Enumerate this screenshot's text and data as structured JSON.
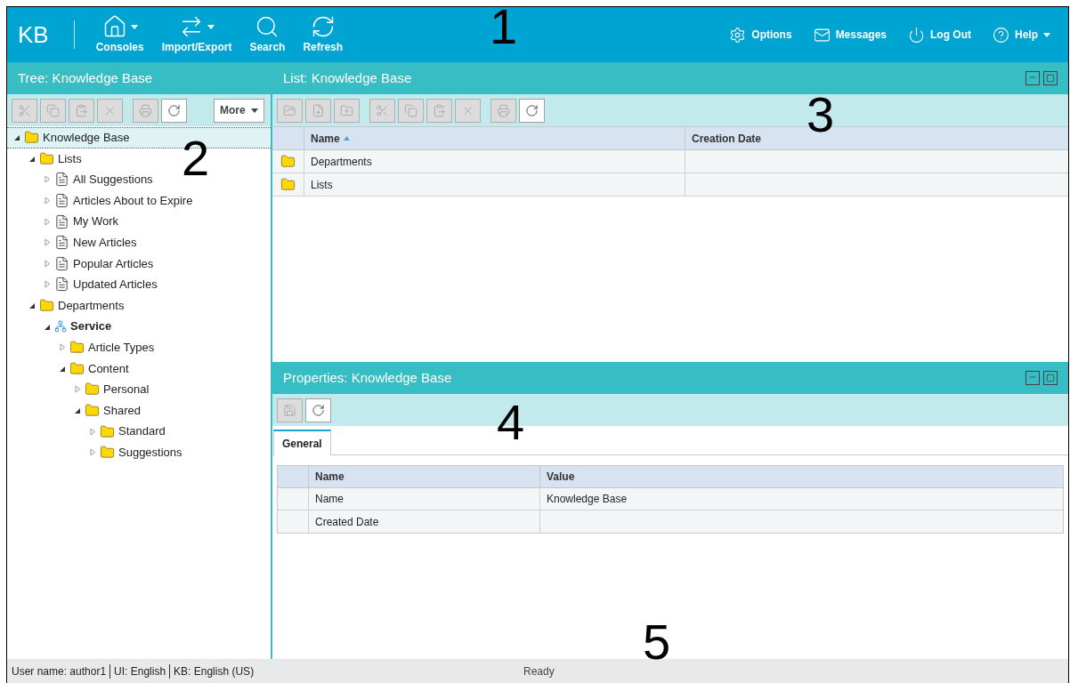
{
  "top_bar": {
    "logo": "KB",
    "tools": [
      {
        "label": "Consoles",
        "dropdown": true
      },
      {
        "label": "Import/Export",
        "dropdown": true
      },
      {
        "label": "Search",
        "dropdown": false
      },
      {
        "label": "Refresh",
        "dropdown": false
      }
    ],
    "links": [
      {
        "label": "Options",
        "dropdown": false
      },
      {
        "label": "Messages",
        "dropdown": false
      },
      {
        "label": "Log Out",
        "dropdown": false
      },
      {
        "label": "Help",
        "dropdown": true
      }
    ]
  },
  "tree_panel": {
    "title": "Tree: Knowledge Base",
    "toolbar": [
      [
        {
          "kind": "cut",
          "disabled": true
        },
        {
          "kind": "copy",
          "disabled": true
        },
        {
          "kind": "paste",
          "disabled": true
        },
        {
          "kind": "delete",
          "disabled": true
        }
      ],
      [
        {
          "kind": "print",
          "disabled": true
        },
        {
          "kind": "refresh",
          "disabled": false
        }
      ]
    ],
    "more_button": "More",
    "tree": [
      {
        "label": "Knowledge Base",
        "kind": "folder",
        "expanded": true,
        "selected": true,
        "children": [
          {
            "label": "Lists",
            "kind": "folder",
            "expanded": true,
            "selected": false,
            "children": [
              {
                "label": "All Suggestions",
                "kind": "list",
                "expanded": false,
                "selected": false
              },
              {
                "label": "Articles About to Expire",
                "kind": "list",
                "expanded": false,
                "selected": false
              },
              {
                "label": "My Work",
                "kind": "list",
                "expanded": false,
                "selected": false
              },
              {
                "label": "New Articles",
                "kind": "list",
                "expanded": false,
                "selected": false
              },
              {
                "label": "Popular Articles",
                "kind": "list",
                "expanded": false,
                "selected": false
              },
              {
                "label": "Updated Articles",
                "kind": "list",
                "expanded": false,
                "selected": false
              }
            ]
          },
          {
            "label": "Departments",
            "kind": "folder",
            "expanded": true,
            "selected": false,
            "children": [
              {
                "label": "Service",
                "kind": "department",
                "expanded": true,
                "selected": false,
                "children": [
                  {
                    "label": "Article Types",
                    "kind": "folder",
                    "expanded": false,
                    "selected": false
                  },
                  {
                    "label": "Content",
                    "kind": "folder",
                    "expanded": true,
                    "selected": false,
                    "children": [
                      {
                        "label": "Personal",
                        "kind": "folder",
                        "expanded": false,
                        "selected": false
                      },
                      {
                        "label": "Shared",
                        "kind": "folder",
                        "expanded": true,
                        "selected": false,
                        "children": [
                          {
                            "label": "Standard",
                            "kind": "folder",
                            "expanded": false,
                            "selected": false
                          },
                          {
                            "label": "Suggestions",
                            "kind": "folder",
                            "expanded": false,
                            "selected": false
                          }
                        ]
                      }
                    ]
                  }
                ]
              }
            ]
          }
        ]
      }
    ]
  },
  "list_panel": {
    "title": "List: Knowledge Base",
    "toolbar": [
      [
        {
          "kind": "open",
          "disabled": true
        },
        {
          "kind": "new",
          "disabled": true
        },
        {
          "kind": "upload",
          "disabled": true
        }
      ],
      [
        {
          "kind": "cut",
          "disabled": true
        },
        {
          "kind": "copy",
          "disabled": true
        },
        {
          "kind": "paste",
          "disabled": true
        },
        {
          "kind": "delete",
          "disabled": true
        }
      ],
      [
        {
          "kind": "print",
          "disabled": true
        },
        {
          "kind": "refresh",
          "disabled": false
        }
      ]
    ],
    "table": {
      "columns": [
        {
          "label": "Name",
          "sorted": true
        },
        {
          "label": "Creation Date",
          "sorted": false
        }
      ],
      "rows": [
        {
          "name": "Departments"
        },
        {
          "name": "Lists"
        }
      ]
    }
  },
  "properties_panel": {
    "title": "Properties: Knowledge Base",
    "toolbar": [
      [
        {
          "kind": "save",
          "disabled": true
        },
        {
          "kind": "refresh",
          "disabled": false
        }
      ]
    ],
    "tabs": [
      {
        "label": "General",
        "selected": true
      }
    ],
    "table": {
      "columns": [
        "Name",
        "Value"
      ],
      "rows": [
        {
          "name": "Name",
          "value": "Knowledge Base"
        },
        {
          "name": "Created Date"
        }
      ]
    }
  },
  "status_bar": {
    "items": [
      "User name: author1",
      "UI: English",
      "KB: English (US)"
    ],
    "status": "Ready"
  },
  "callouts": [
    "1",
    "2",
    "3",
    "4",
    "5"
  ]
}
